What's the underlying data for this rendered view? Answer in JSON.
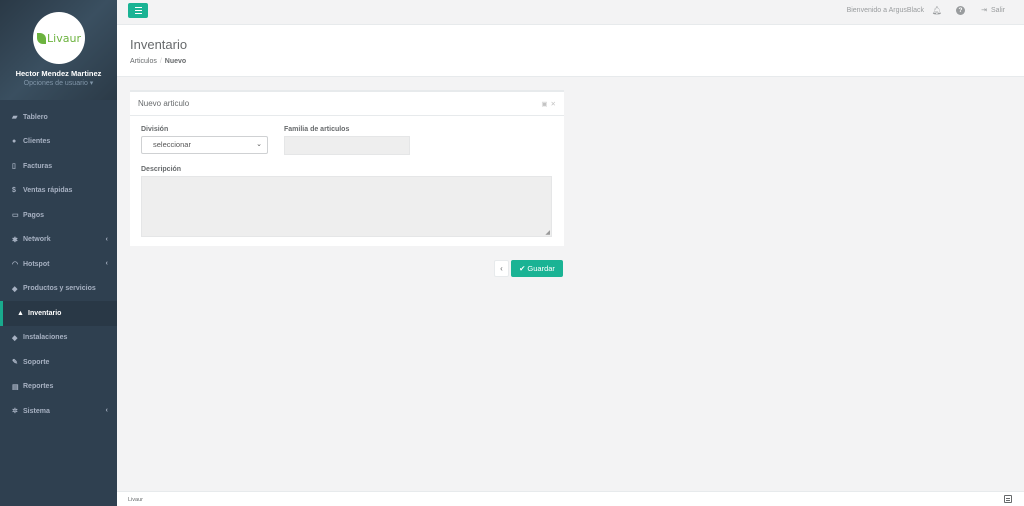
{
  "brand": {
    "logo_text": "Livaur",
    "logo_color": "#6cb33f"
  },
  "user": {
    "name": "Hector Mendez Martinez",
    "options_label": "Opciones de usuario ▾"
  },
  "sidebar": {
    "items": [
      {
        "label": "Tablero",
        "icon": "dashboard-icon",
        "glyph": "▰",
        "chevron": false
      },
      {
        "label": "Clientes",
        "icon": "users-icon",
        "glyph": "●",
        "chevron": false
      },
      {
        "label": "Facturas",
        "icon": "file-icon",
        "glyph": "▯",
        "chevron": false
      },
      {
        "label": "Ventas rápidas",
        "icon": "dollar-icon",
        "glyph": "$",
        "chevron": false
      },
      {
        "label": "Pagos",
        "icon": "money-icon",
        "glyph": "▭",
        "chevron": false
      },
      {
        "label": "Network",
        "icon": "sitemap-icon",
        "glyph": "✱",
        "chevron": true
      },
      {
        "label": "Hotspot",
        "icon": "wifi-icon",
        "glyph": "◠",
        "chevron": true
      },
      {
        "label": "Productos y servicios",
        "icon": "tags-icon",
        "glyph": "◆",
        "chevron": false
      },
      {
        "label": "Inventario",
        "icon": "cubes-icon",
        "glyph": "▲",
        "chevron": false,
        "active": true
      },
      {
        "label": "Instalaciones",
        "icon": "tag-icon",
        "glyph": "◆",
        "chevron": false
      },
      {
        "label": "Soporte",
        "icon": "wrench-icon",
        "glyph": "✎",
        "chevron": false
      },
      {
        "label": "Reportes",
        "icon": "book-icon",
        "glyph": "▤",
        "chevron": false
      },
      {
        "label": "Sistema",
        "icon": "cogs-icon",
        "glyph": "✲",
        "chevron": true
      }
    ],
    "chevron_glyph": "‹"
  },
  "topbar": {
    "welcome": "Bienvenido a ArgusBlack",
    "logout": "Salir",
    "accent_color": "#1ab394"
  },
  "header": {
    "title": "Inventario",
    "breadcrumb": {
      "parent": "Articulos",
      "separator": "/",
      "current": "Nuevo"
    }
  },
  "panel": {
    "title": "Nuevo articulo",
    "division_label": "División",
    "division_value": "seleccionar",
    "familia_label": "Familia de articulos",
    "descripcion_label": "Descripción"
  },
  "actions": {
    "back_glyph": "‹",
    "save_label": "Guardar"
  },
  "footer": {
    "text": "Livaur"
  }
}
